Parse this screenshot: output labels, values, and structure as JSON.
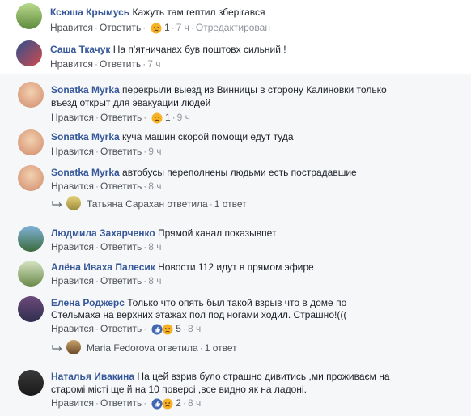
{
  "actions": {
    "like": "Нравится",
    "reply": "Ответить",
    "sep": "·"
  },
  "comments": [
    {
      "author": "Ксюша Крымусь",
      "text": "Кажуть там гептил зберігався",
      "reactions": "1",
      "time": "7 ч",
      "edited": "Отредактирован"
    },
    {
      "author": "Саша Ткачук",
      "text": "На п'ятничанах був поштовх сильний !",
      "time": "7 ч"
    },
    {
      "author": "Sonatka Myrka",
      "text1": "перекрыли выезд из Винницы в сторону Калиновки только",
      "text2": "въезд открыт для эвакуации людей",
      "reactions": "1",
      "time": "9 ч"
    },
    {
      "author": "Sonatka Myrka",
      "text": "куча машин скорой помощи едут туда",
      "time": "9 ч"
    },
    {
      "author": "Sonatka Myrka",
      "text": "автобусы переполнены людьми есть пострадавшие",
      "time": "8 ч",
      "reply_author": "Татьяна Сарахан",
      "reply_text": "ответила",
      "reply_count": "1 ответ"
    },
    {
      "author": "Людмила Захарченко",
      "text": "Прямой канал показывпет",
      "time": "8 ч"
    },
    {
      "author": "Алёна Иваха Палесик",
      "text": "Новости 112 идут в прямом эфире",
      "time": "8 ч"
    },
    {
      "author": "Елена Роджерс",
      "text1": "Только что опять был такой взрыв что в доме по",
      "text2": "Стельмаха на верхних этажах пол под ногами ходил. Страшно!(((",
      "reactions": "5",
      "time": "8 ч",
      "reply_author": "Maria Fedorova",
      "reply_text": "ответила",
      "reply_count": "1 ответ"
    },
    {
      "author": "Наталья Ивакина",
      "text1": "На цей взрив було страшно дивитись ,ми проживаєм на",
      "text2": "старомі місті ще й на 10 поверсі ,все видно як на ладоні.",
      "reactions": "2",
      "time": "8 ч"
    }
  ],
  "colors": {
    "link": "#365899",
    "meta": "#90949c",
    "like_blue": "#4267b2",
    "haha_yellow": "#f7b125"
  }
}
